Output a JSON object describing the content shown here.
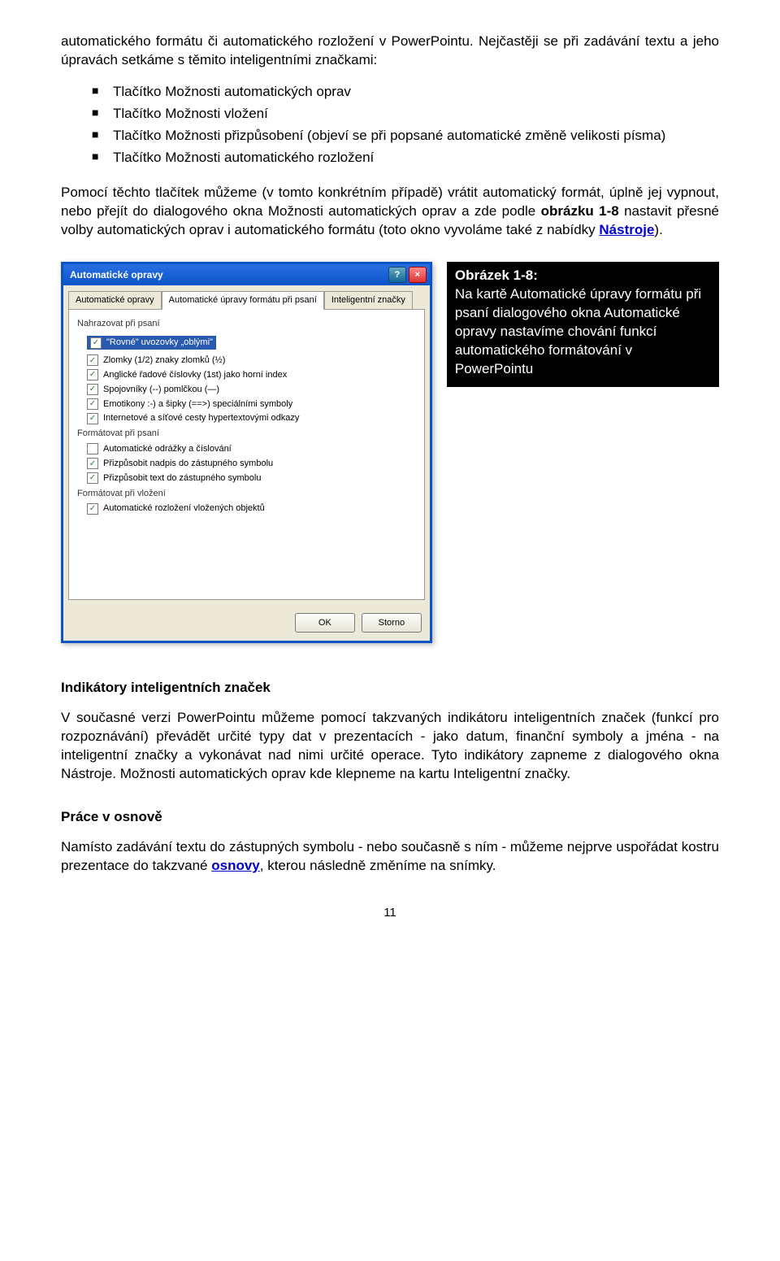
{
  "intro": {
    "p1a": "automatického formátu či automatického rozložení v PowerPointu. Nejčastěji se při zadávání textu a jeho úpravách setkáme s těmito inteligentními značkami:",
    "bullets": [
      "Tlačítko Možnosti automatických oprav",
      "Tlačítko Možnosti vložení",
      "Tlačítko Možnosti přizpůsobení (objeví se při popsané automatické změně velikosti písma)",
      "Tlačítko Možnosti automatického rozložení"
    ],
    "p2a": "Pomocí těchto tlačítek můžeme (v tomto konkrétním případě) vrátit automatický formát, úplně jej vypnout, nebo přejít do dialogového okna Možnosti automatických oprav a zde podle ",
    "p2_bold": "obrázku 1-8",
    "p2b": " nastavit přesné volby automatických oprav i automatického formátu (toto okno vyvoláme také z nabídky ",
    "p2_link": "Nástroje",
    "p2c": ")."
  },
  "dialog": {
    "title": "Automatické opravy",
    "tabs": [
      "Automatické opravy",
      "Automatické úpravy formátu při psaní",
      "Inteligentní značky"
    ],
    "group1": "Nahrazovat při psaní",
    "items1": [
      "\"Rovné\" uvozovky „oblými\"",
      "Zlomky (1/2) znaky zlomků (½)",
      "Anglické řadové číslovky (1st) jako horní index",
      "Spojovníky (--) pomlčkou (—)",
      "Emotikony :-) a šipky (==>) speciálními symboly",
      "Internetové a síťové cesty hypertextovými odkazy"
    ],
    "group2": "Formátovat při psaní",
    "items2": [
      "Automatické odrážky a číslování",
      "Přizpůsobit nadpis do zástupného symbolu",
      "Přizpůsobit text do zástupného symbolu"
    ],
    "group3": "Formátovat při vložení",
    "items3": [
      "Automatické rozložení vložených objektů"
    ],
    "ok": "OK",
    "cancel": "Storno"
  },
  "caption": {
    "title": "Obrázek 1-8:",
    "text": "Na kartě Automatické úpravy formátu při psaní dialogového okna Automatické opravy nastavíme chování funkcí automatického formátování v PowerPointu"
  },
  "section2": {
    "heading": "Indikátory inteligentních značek",
    "p": "V současné verzi PowerPointu můžeme pomocí takzvaných indikátoru inteligentních značek (funkcí pro rozpoznávání) převádět určité typy dat v prezentacích - jako datum, finanční symboly a jména - na inteligentní značky a vykonávat nad nimi určité operace. Tyto indikátory zapneme z dialogového okna Nástroje. Možnosti automatických oprav kde klepneme na kartu Inteligentní značky."
  },
  "section3": {
    "heading": "Práce v osnově",
    "p_a": "Namísto zadávání textu do zástupných symbolu - nebo současně s ním - můžeme nejprve uspořádat kostru prezentace do takzvané ",
    "p_link": "osnovy",
    "p_b": ", kterou následně změníme na snímky."
  },
  "pagenum": "11"
}
